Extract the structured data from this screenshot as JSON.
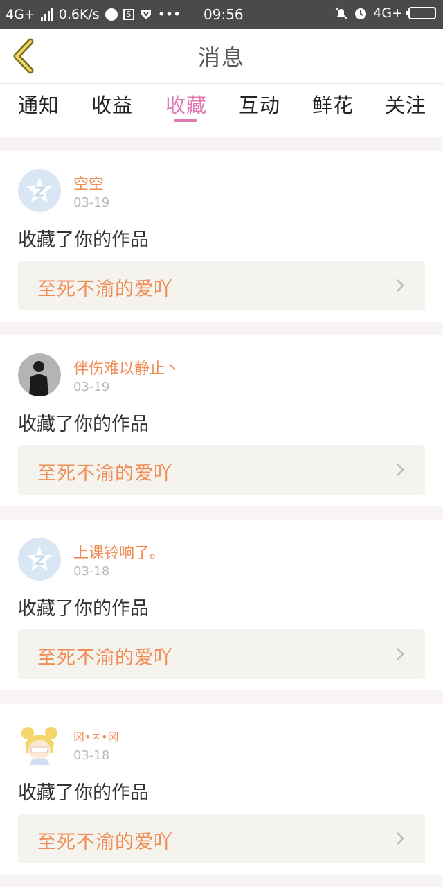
{
  "status_bar": {
    "network": "4G+",
    "speed": "0.6K/s",
    "time": "09:56",
    "network_right": "4G+",
    "dots": "•••",
    "s_badge": "S"
  },
  "header": {
    "title": "消息"
  },
  "tabs": [
    {
      "label": "通知"
    },
    {
      "label": "收益"
    },
    {
      "label": "收藏"
    },
    {
      "label": "互动"
    },
    {
      "label": "鲜花"
    },
    {
      "label": "关注"
    }
  ],
  "active_tab": "收藏",
  "colors": {
    "accent": "#e07ab2",
    "name": "#f08c55",
    "work": "#f08c55"
  },
  "messages": [
    {
      "user": "空空",
      "date": "03-19",
      "action": "收藏了你的作品",
      "work": "至死不渝的爱吖",
      "avatar": "qzone-default-avatar"
    },
    {
      "user": "伴伤难以静止丶",
      "date": "03-19",
      "action": "收藏了你的作品",
      "work": "至死不渝的爱吖",
      "avatar": "dark-photo-avatar"
    },
    {
      "user": "上课铃响了。",
      "date": "03-18",
      "action": "收藏了你的作品",
      "work": "至死不渝的爱吖",
      "avatar": "qzone-default-avatar"
    },
    {
      "user": "冈•ㅈ•冈",
      "date": "03-18",
      "action": "收藏了你的作品",
      "work": "至死不渝的爱吖",
      "avatar": "anime-girl-avatar"
    }
  ]
}
